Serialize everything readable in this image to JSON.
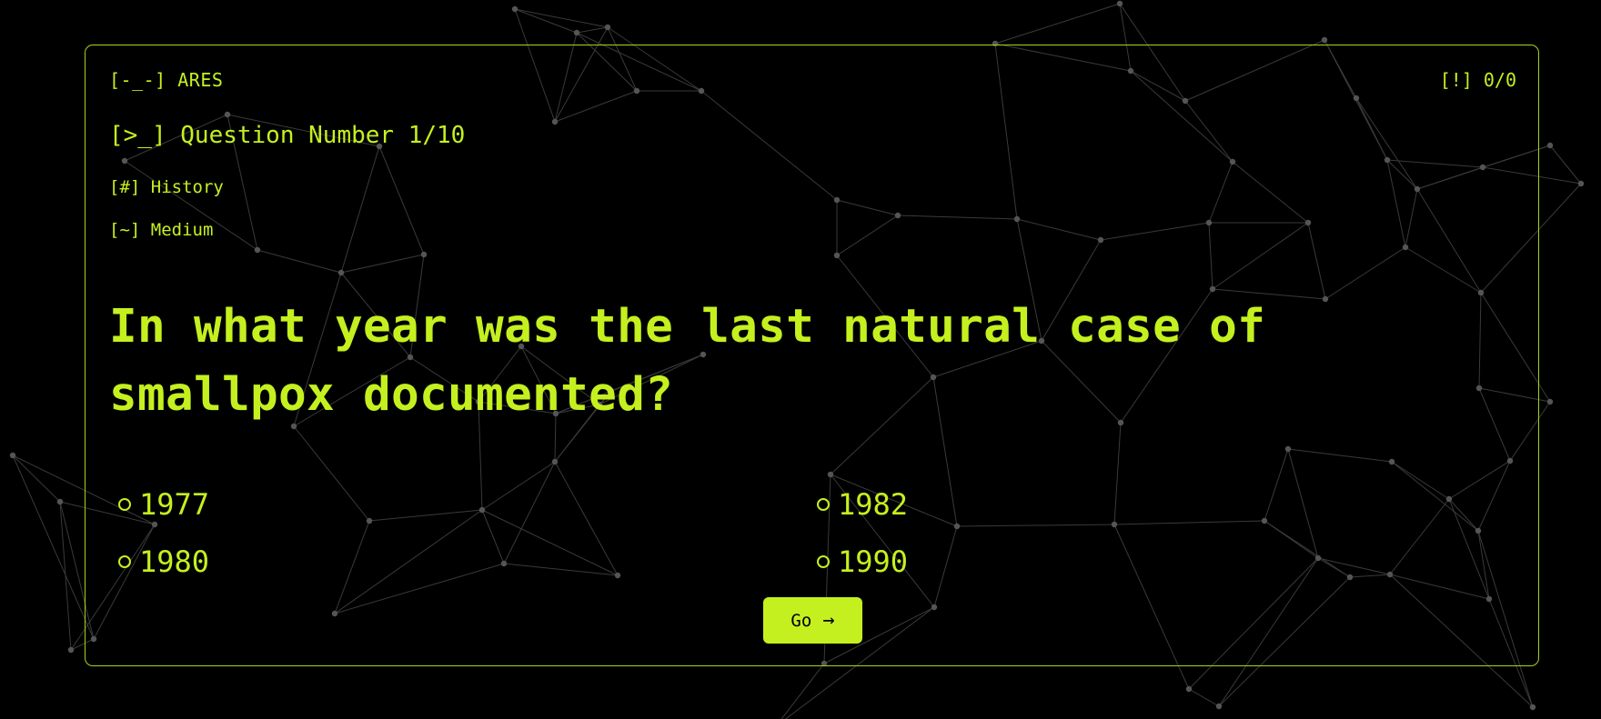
{
  "header": {
    "brand": "[-_-] ARES",
    "score": "[!] 0/0"
  },
  "quiz": {
    "question_number": "[>_] Question Number 1/10",
    "category": "[#] History",
    "difficulty": "[~] Medium",
    "question": "In what year was the last natural case of smallpox documented?",
    "options": [
      "1977",
      "1982",
      "1980",
      "1990"
    ],
    "submit_label": "Go",
    "submit_icon": "→"
  },
  "colors": {
    "accent": "#c5f01f",
    "background": "#000000",
    "network": "#3a3a3a"
  }
}
